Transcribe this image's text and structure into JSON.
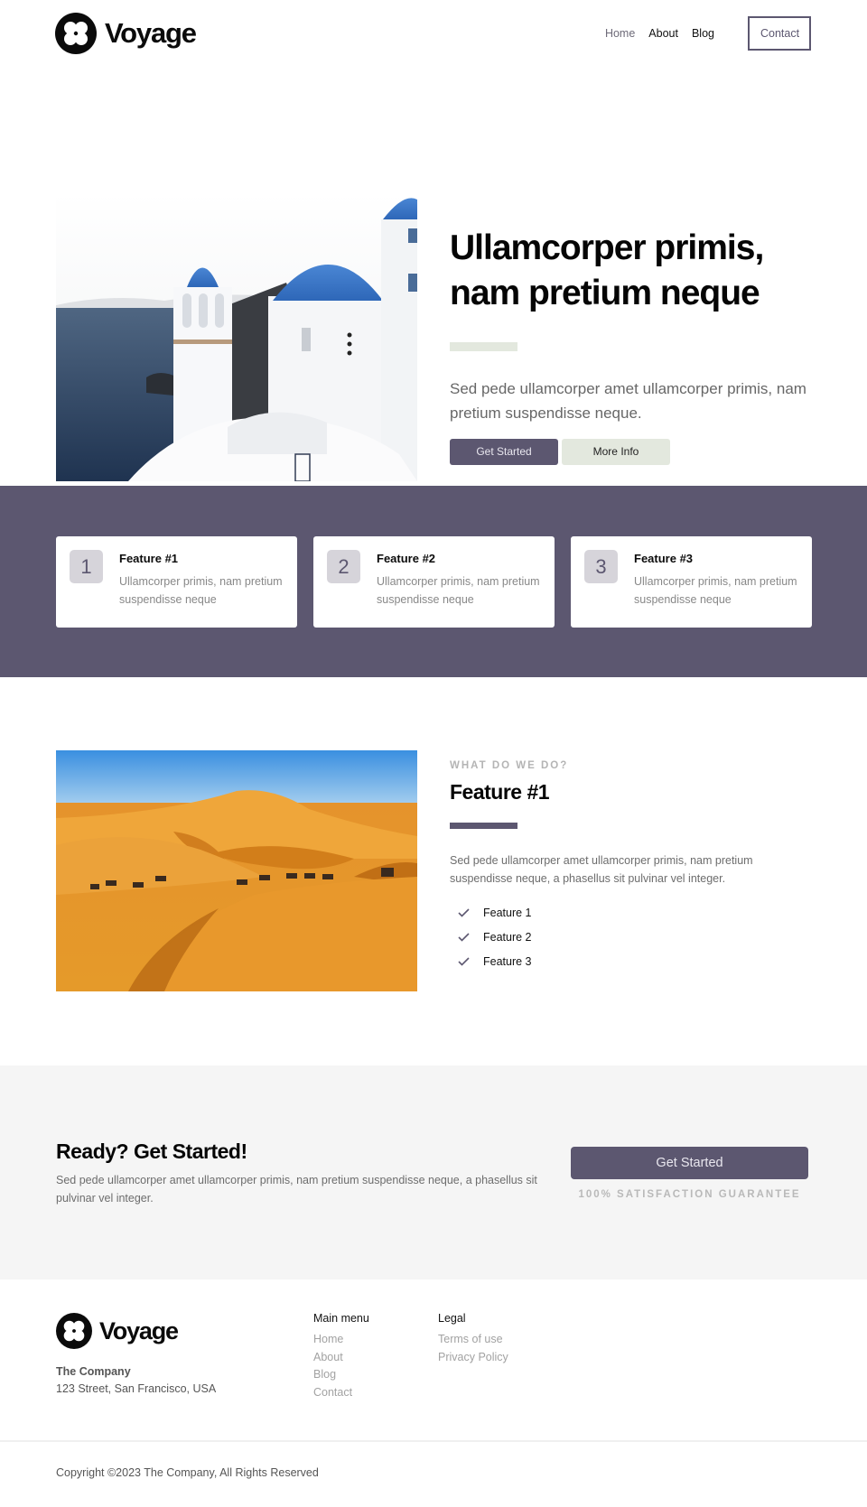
{
  "brand": {
    "name": "Voyage",
    "primary_color": "#5c5770",
    "accent_light": "#e3e8de",
    "logo_icon": "four-petal-circle-icon"
  },
  "nav": {
    "items": [
      {
        "label": "Home"
      },
      {
        "label": "About"
      },
      {
        "label": "Blog"
      }
    ],
    "contact_label": "Contact"
  },
  "hero": {
    "image_alt": "Santorini white church with blue domes overlooking the sea",
    "title": "Ullamcorper primis, nam pretium neque",
    "description": "Sed pede ullamcorper amet ullamcorper primis, nam pretium suspendisse neque.",
    "primary_button": "Get Started",
    "secondary_button": "More Info"
  },
  "features": [
    {
      "number": "1",
      "title": "Feature #1",
      "description": "Ullamcorper primis, nam pretium suspendisse neque"
    },
    {
      "number": "2",
      "title": "Feature #2",
      "description": "Ullamcorper primis, nam pretium suspendisse neque"
    },
    {
      "number": "3",
      "title": "Feature #3",
      "description": "Ullamcorper primis, nam pretium suspendisse neque"
    }
  ],
  "what": {
    "image_alt": "Camel caravan crossing orange desert sand dunes",
    "eyebrow": "WHAT DO WE DO?",
    "title": "Feature #1",
    "description": "Sed pede ullamcorper amet ullamcorper primis, nam pretium suspendisse neque, a phasellus sit pulvinar vel integer.",
    "list": [
      "Feature 1",
      "Feature 2",
      "Feature 3"
    ]
  },
  "cta": {
    "title": "Ready? Get Started!",
    "description": "Sed pede ullamcorper amet ullamcorper primis, nam pretium suspendisse neque, a phasellus sit pulvinar vel integer.",
    "button": "Get Started",
    "guarantee": "100% SATISFACTION GUARANTEE"
  },
  "footer": {
    "company": "The Company",
    "address": "123 Street, San Francisco, USA",
    "main_menu": {
      "heading": "Main menu",
      "links": [
        "Home",
        "About",
        "Blog",
        "Contact"
      ]
    },
    "legal": {
      "heading": "Legal",
      "links": [
        "Terms of use",
        "Privacy Policy"
      ]
    },
    "copyright": "Copyright ©2023 The Company, All Rights Reserved"
  }
}
